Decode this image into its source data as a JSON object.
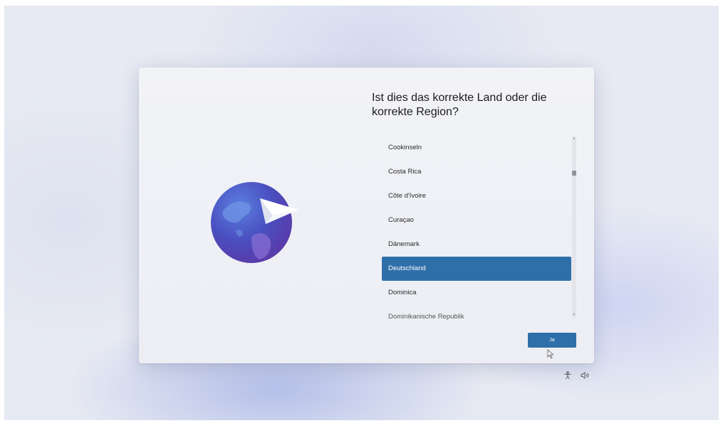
{
  "dialog": {
    "title": "Ist dies das korrekte Land oder die korrekte Region?",
    "countries": [
      {
        "label": "Cookinseln",
        "selected": false
      },
      {
        "label": "Costa Rica",
        "selected": false
      },
      {
        "label": "Côte d'Ivoire",
        "selected": false
      },
      {
        "label": "Curaçao",
        "selected": false
      },
      {
        "label": "Dänemark",
        "selected": false
      },
      {
        "label": "Deutschland",
        "selected": true
      },
      {
        "label": "Dominica",
        "selected": false
      },
      {
        "label": "Dominikanische Republik",
        "selected": false
      }
    ],
    "confirm_label": "Ja"
  },
  "taskbar": {
    "icons": [
      "accessibility-icon",
      "volume-icon"
    ]
  },
  "colors": {
    "accent": "#2f6fa9",
    "dialog_bg": "#f2f3f7",
    "globe": "#4a4fc0"
  }
}
